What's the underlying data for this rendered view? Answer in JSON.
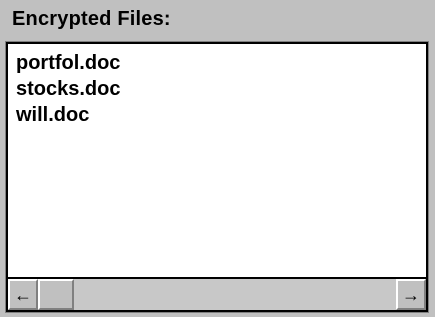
{
  "panel": {
    "label": "Encrypted Files:"
  },
  "files": {
    "items": [
      {
        "name": "portfol.doc"
      },
      {
        "name": "stocks.doc"
      },
      {
        "name": "will.doc"
      }
    ]
  },
  "scrollbar": {
    "left_arrow": "←",
    "right_arrow": "→",
    "left_icon": "left-arrow-icon",
    "right_icon": "right-arrow-icon"
  },
  "colors": {
    "background": "#c0c0c0",
    "list_background": "#ffffff",
    "text": "#000000"
  }
}
